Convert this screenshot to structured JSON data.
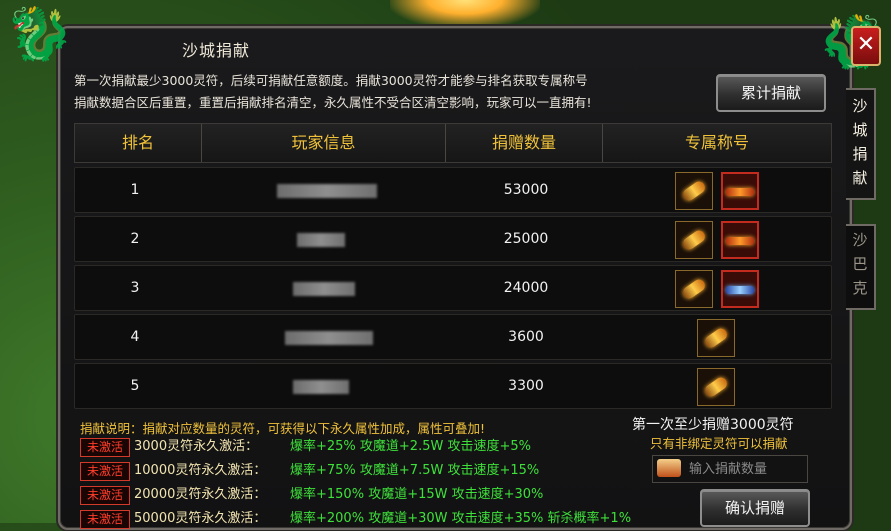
{
  "window": {
    "title": "沙城捐献",
    "close_glyph": "✕"
  },
  "notice": {
    "line1": "第一次捐献最少3000灵符，后续可捐献任意额度。捐献3000灵符才能参与排名获取专属称号",
    "line2": "捐献数据合区后重置，重置后捐献排名清空，永久属性不受合区清空影响，玩家可以一直拥有!"
  },
  "buttons": {
    "cumulative": "累计捐献",
    "confirm": "确认捐赠"
  },
  "side_tabs": [
    {
      "label": "沙城捐献",
      "active": true
    },
    {
      "label": "沙巴克",
      "active": false
    }
  ],
  "table": {
    "headers": [
      "排名",
      "玩家信息",
      "捐赠数量",
      "专属称号"
    ],
    "rows": [
      {
        "rank": "1",
        "amount": "53000",
        "badges": [
          "gold-title-icon",
          "red-title-icon"
        ]
      },
      {
        "rank": "2",
        "amount": "25000",
        "badges": [
          "gold-title-icon",
          "red-title-icon"
        ]
      },
      {
        "rank": "3",
        "amount": "24000",
        "badges": [
          "gold-title-icon",
          "blue-title-icon"
        ]
      },
      {
        "rank": "4",
        "amount": "3600",
        "badges": [
          "gold-title-icon"
        ]
      },
      {
        "rank": "5",
        "amount": "3300",
        "badges": [
          "red-gold-title-icon"
        ]
      }
    ]
  },
  "donation": {
    "description": "捐献说明：捐献对应数量的灵符，可获得以下永久属性加成，属性可叠加!",
    "tiers": [
      {
        "status": "未激活",
        "name": "3000灵符永久激活：",
        "attrs": "爆率+25% 攻魔道+2.5W 攻击速度+5%"
      },
      {
        "status": "未激活",
        "name": "10000灵符永久激活：",
        "attrs": "爆率+75% 攻魔道+7.5W 攻击速度+15%"
      },
      {
        "status": "未激活",
        "name": "20000灵符永久激活：",
        "attrs": "爆率+150% 攻魔道+15W 攻击速度+30%"
      },
      {
        "status": "未激活",
        "name": "50000灵符永久激活：",
        "attrs": "爆率+200% 攻魔道+30W 攻击速度+35% 斩杀概率+1%"
      }
    ],
    "min_note": "第一次至少捐赠3000灵符",
    "unbound_note": "只有非绑定灵符可以捐献",
    "input_placeholder": "输入捐献数量"
  },
  "colors": {
    "accent_gold": "#f0c23a",
    "attr_green": "#3ee03a",
    "inactive_red": "#ff3d2a"
  }
}
